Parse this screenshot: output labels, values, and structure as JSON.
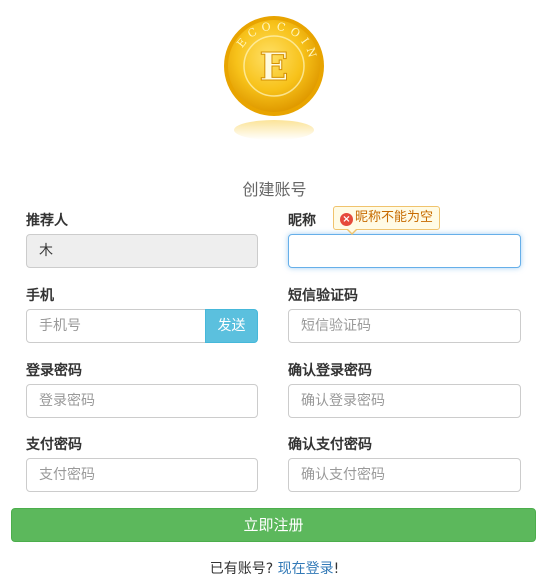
{
  "logo": {
    "ring_text": "ECOCOIN",
    "letter": "E"
  },
  "page_title": "创建账号",
  "fields": {
    "referrer": {
      "label": "推荐人",
      "value": "木"
    },
    "nickname": {
      "label": "昵称",
      "value": "",
      "error": "昵称不能为空"
    },
    "phone": {
      "label": "手机",
      "placeholder": "手机号",
      "send_label": "发送"
    },
    "sms_code": {
      "label": "短信验证码",
      "placeholder": "短信验证码"
    },
    "login_password": {
      "label": "登录密码",
      "placeholder": "登录密码"
    },
    "login_password_confirm": {
      "label": "确认登录密码",
      "placeholder": "确认登录密码"
    },
    "pay_password": {
      "label": "支付密码",
      "placeholder": "支付密码"
    },
    "pay_password_confirm": {
      "label": "确认支付密码",
      "placeholder": "确认支付密码"
    }
  },
  "submit_label": "立即注册",
  "footer": {
    "prefix": "已有账号?",
    "link": "现在登录",
    "suffix": "!"
  },
  "colors": {
    "primary_green": "#5cb85c",
    "info_blue": "#5bc0de",
    "link_blue": "#337ab7",
    "error_orange": "#c76b00",
    "coin_gold": "#f5b800"
  }
}
